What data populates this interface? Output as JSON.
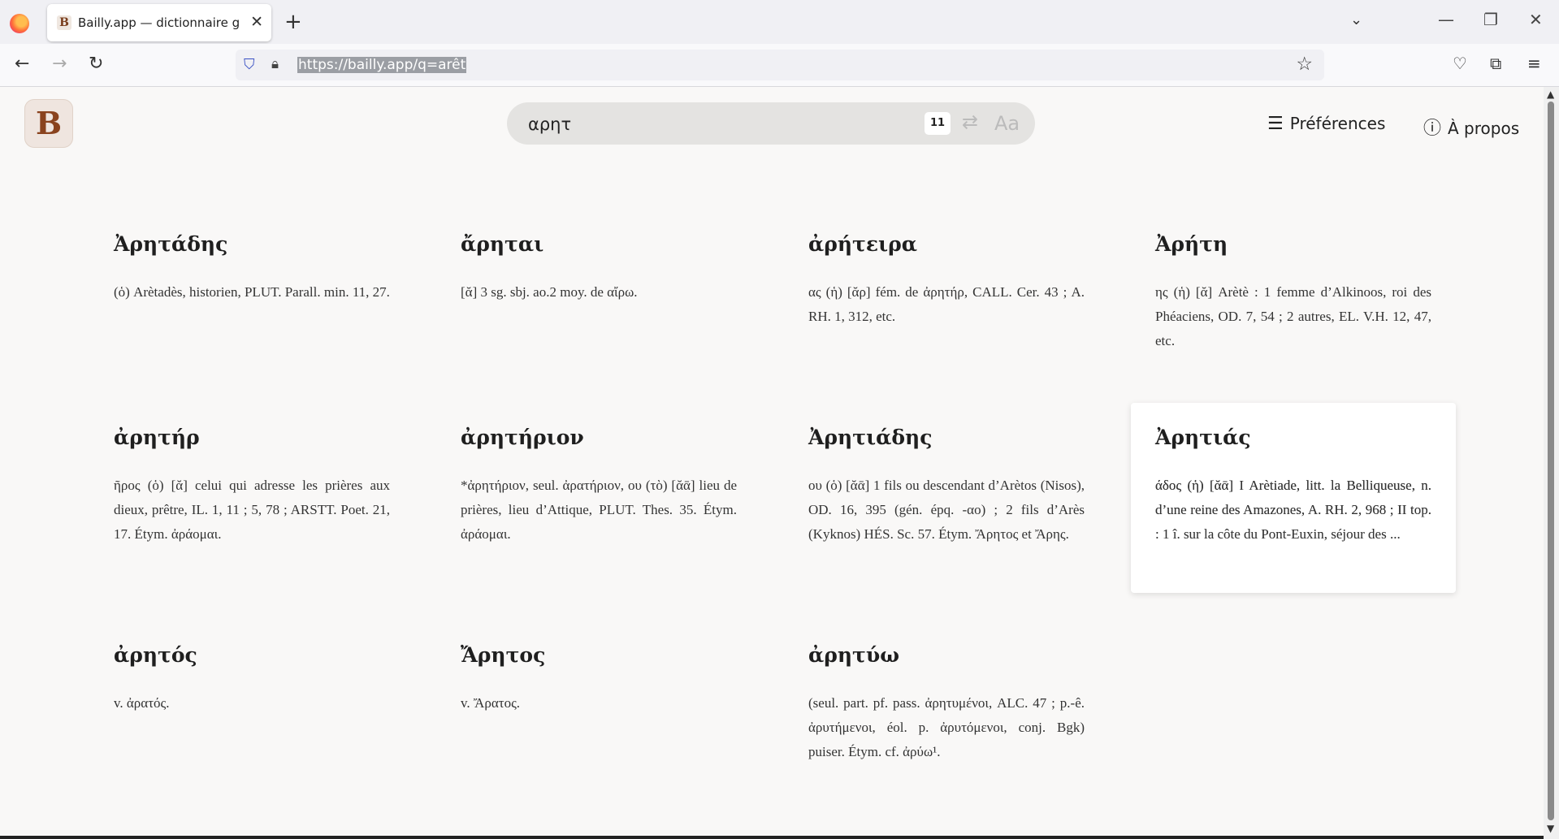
{
  "browser": {
    "tab_title": "Bailly.app — dictionnaire grec-français",
    "tab_favicon": "B",
    "url": "https://bailly.app/q=arêt"
  },
  "site": {
    "logo": "B",
    "search_value": "αρητ",
    "result_count": "11",
    "case_label": "Aa",
    "preferences_label": "Préférences",
    "about_label": "À propos"
  },
  "entries": [
    {
      "headword": "Ἀρητάδης",
      "definition": "(ὁ) Arètadès, historien, PLUT. Parall. min. 11, 27."
    },
    {
      "headword": "ἄρηται",
      "definition": "[ᾰ] 3 sg. sbj. ao.2 moy. de αἴρω."
    },
    {
      "headword": "ἀρήτειρα",
      "definition": "ας (ἡ) [ᾰρ] fém. de ἀρητήρ, CALL. Cer. 43 ; A. RH. 1, 312, etc."
    },
    {
      "headword": "Ἀρήτη",
      "definition": "ης (ἡ) [ᾰ] Arètè : 1 femme d’Alkinoos, roi des Phéaciens, OD. 7, 54 ; 2 autres, EL. V.H. 12, 47, etc."
    },
    {
      "headword": "ἀρητήρ",
      "definition": "ῆρος (ὁ) [ᾰ] celui qui adresse les prières aux dieux, prêtre, IL. 1, 11 ; 5, 78 ; ARSTT. Poet. 21, 17. Étym. ἀράομαι."
    },
    {
      "headword": "ἀρητήριον",
      "definition": "*ἀρητήριον, seul. ἀρατήριον, ου (τὸ) [ᾰᾱ] lieu de prières, lieu d’Attique, PLUT. Thes. 35. Étym. ἀράομαι."
    },
    {
      "headword": "Ἀρητιάδης",
      "definition": "ου (ὁ) [ᾰᾱ] 1 fils ou descendant d’Arètos (Nisos), OD. 16, 395 (gén. épq. -αο) ; 2 fils d’Arès (Kyknos) HÉS. Sc. 57. Étym. Ἄρητος et Ἄρης."
    },
    {
      "headword": "Ἀρητιάς",
      "definition": "άδος (ἡ) [ᾰᾱ] I Arètiade, litt. la Belliqueuse, n. d’une reine des Amazones, A. RH. 2, 968 ; II top. : 1 î. sur la côte du Pont-Euxin, séjour des ..."
    },
    {
      "headword": "ἀρητός",
      "definition": "v. ἀρατός."
    },
    {
      "headword": "Ἄρητος",
      "definition": "v. Ἄρατος."
    },
    {
      "headword": "ἀρητύω",
      "definition": "(seul. part. pf. pass. ἀρητυμένοι, ALC. 47 ; p.-ê. ἀρυτήμενοι, éol. p. ἀρυτόμενοι, conj. Bgk) puiser. Étym. cf. ἀρύω¹."
    }
  ]
}
